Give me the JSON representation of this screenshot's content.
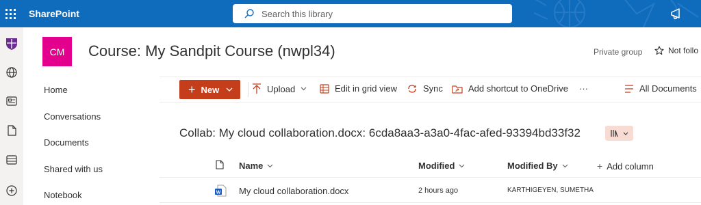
{
  "suitebar": {
    "app_name": "SharePoint",
    "search_placeholder": "Search this library",
    "brand_color": "#0f6cbd"
  },
  "appbar": {
    "items": [
      "university-icon",
      "globe-icon",
      "news-icon",
      "file-icon",
      "list-icon",
      "add-icon"
    ]
  },
  "site": {
    "logo_text": "CM",
    "logo_color": "#e3008c",
    "title": "Course: My Sandpit Course (nwpl34)",
    "privacy": "Private group",
    "follow_label": "Not follo"
  },
  "nav": {
    "items": [
      "Home",
      "Conversations",
      "Documents",
      "Shared with us",
      "Notebook"
    ]
  },
  "commands": {
    "new_label": "New",
    "new_color": "#c43e1c",
    "upload_label": "Upload",
    "grid_label": "Edit in grid view",
    "sync_label": "Sync",
    "shortcut_label": "Add shortcut to OneDrive",
    "more_label": "···",
    "view_label": "All Documents"
  },
  "library": {
    "title": "Collab: My cloud collaboration.docx: 6cda8aa3-a3a0-4fac-afed-93394bd33f32"
  },
  "table": {
    "columns": {
      "name": "Name",
      "modified": "Modified",
      "modified_by": "Modified By",
      "add_column": "Add column"
    },
    "rows": [
      {
        "name": "My cloud collaboration.docx",
        "modified": "2 hours ago",
        "modified_by": "KARTHIGEYEN, SUMETHA"
      }
    ]
  }
}
